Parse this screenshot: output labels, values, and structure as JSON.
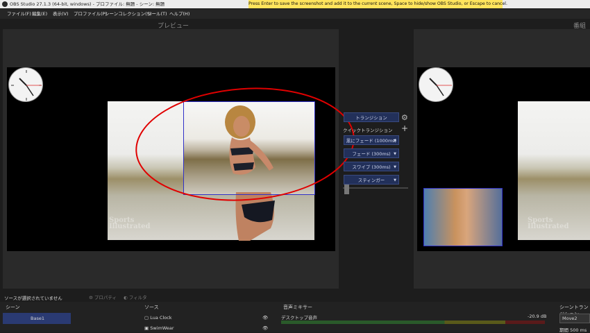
{
  "titlebar": {
    "title": "OBS Studio 27.1.3 (64-bit, windows) - プロファイル: 無題 - シーン: 無題"
  },
  "notice": {
    "text": "Press Enter to save the screenshot and add it to the current scene, Space to hide/show OBS Studio, or Escape to cancel."
  },
  "menu": [
    "ファイル(F)",
    "編集(E)",
    "表示(V)",
    "プロファイル(P)",
    "シーンコレクション(S)",
    "ツール(T)",
    "ヘルプ(H)"
  ],
  "preview_label": "プレビュー",
  "program_label": "番組",
  "watermark": "Sports\nIllustrated",
  "transitions": {
    "main": "トランジション",
    "quick": "クイックトランジション",
    "items": [
      "黒にフェード (1000ms)",
      "フェード (300ms)",
      "スワイプ (300ms)",
      "スティンガー"
    ]
  },
  "status": {
    "no_source": "ソースが選択されていません",
    "properties": "プロパティ",
    "filters": "フィルタ"
  },
  "docks": {
    "scenes": "シーン",
    "sources": "ソース",
    "mixer": "音声ミキサー",
    "transitions": "シーントランジション"
  },
  "scene_item": "Base1",
  "sources": [
    "Lua Clock",
    "SwimWear"
  ],
  "mixer": {
    "channel": "デスクトップ音声",
    "level": "-20.9 dB"
  },
  "transition_select": "Move2",
  "duration_label": "期間",
  "duration_value": "500 ms",
  "colors": {
    "accent": "#2a3a72",
    "annotation": "#e00000",
    "selection": "#3030c8"
  }
}
